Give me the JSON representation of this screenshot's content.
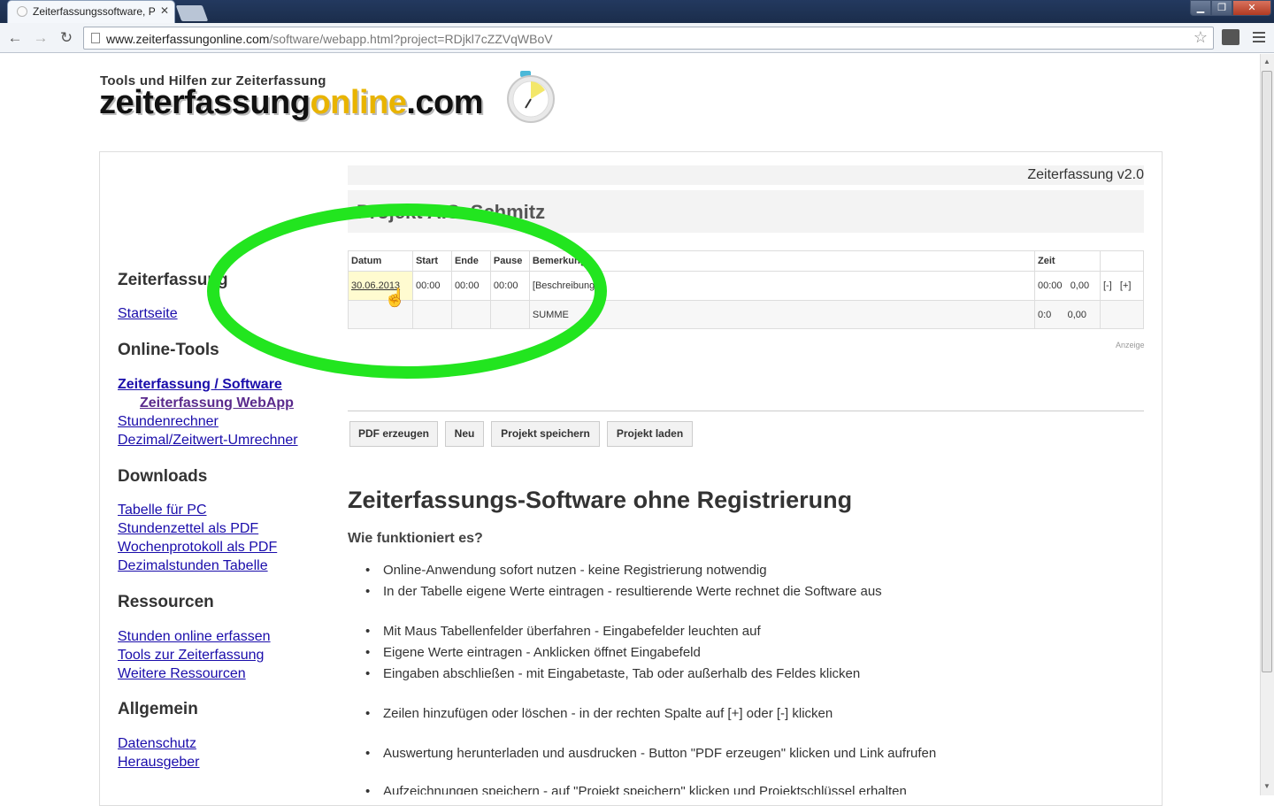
{
  "browser": {
    "tab_title": "Zeiterfassungssoftware, P",
    "url_domain": "www.zeiterfassungonline.com",
    "url_path": "/software/webapp.html?project=RDjkl7cZZVqWBoV"
  },
  "logo": {
    "tagline": "Tools und Hilfen zur Zeiterfassung",
    "part1": "zeiterfassung",
    "part2": "online",
    "part3": ".com"
  },
  "sidebar": {
    "sections": [
      {
        "title": "Zeiterfassung",
        "links": [
          "Startseite"
        ]
      },
      {
        "title": "Online-Tools",
        "links": [
          "Zeiterfassung / Software",
          "Zeiterfassung WebApp",
          "Stundenrechner",
          "Dezimal/Zeitwert-Umrechner"
        ]
      },
      {
        "title": "Downloads",
        "links": [
          "Tabelle für PC",
          "Stundenzettel als PDF",
          "Wochenprotokoll als PDF",
          "Dezimalstunden Tabelle"
        ]
      },
      {
        "title": "Ressourcen",
        "links": [
          "Stunden online erfassen",
          "Tools zur Zeiterfassung",
          "Weitere Ressourcen"
        ]
      },
      {
        "title": "Allgemein",
        "links": [
          "Datenschutz",
          "Herausgeber"
        ]
      }
    ]
  },
  "app": {
    "version": "Zeiterfassung v2.0",
    "project_title": "Projekt A.S. Schmitz",
    "columns": [
      "Datum",
      "Start",
      "Ende",
      "Pause",
      "Bemerkung",
      "Zeit"
    ],
    "row": {
      "datum": "30.06.2013",
      "start": "00:00",
      "ende": "00:00",
      "pause": "00:00",
      "bemerkung": "[Beschreibung]",
      "zeit": "00:00",
      "dezimal": "0,00",
      "minus": "[-]",
      "plus": "[+]"
    },
    "summe": {
      "label": "SUMME",
      "zeit": "0:0",
      "dezimal": "0,00"
    },
    "anzeige": "Anzeige",
    "buttons": [
      "PDF erzeugen",
      "Neu",
      "Projekt speichern",
      "Projekt laden"
    ]
  },
  "article": {
    "heading": "Zeiterfassungs-Software ohne Registrierung",
    "subheading": "Wie funktioniert es?",
    "bullets": [
      "Online-Anwendung sofort nutzen - keine Registrierung notwendig",
      "In der Tabelle eigene Werte eintragen - resultierende Werte rechnet die Software aus",
      "Mit Maus Tabellenfelder überfahren - Eingabefelder leuchten auf",
      "Eigene Werte eintragen - Anklicken öffnet Eingabefeld",
      "Eingaben abschließen - mit Eingabetaste, Tab oder außerhalb des Feldes klicken",
      "Zeilen hinzufügen oder löschen - in der rechten Spalte auf [+] oder [-] klicken",
      "Auswertung herunterladen und ausdrucken - Button \"PDF erzeugen\" klicken und Link aufrufen",
      "Aufzeichnungen speichern - auf \"Projekt speichern\" klicken und Projektschlüssel erhalten"
    ]
  },
  "annotation_color": "#22e51f"
}
